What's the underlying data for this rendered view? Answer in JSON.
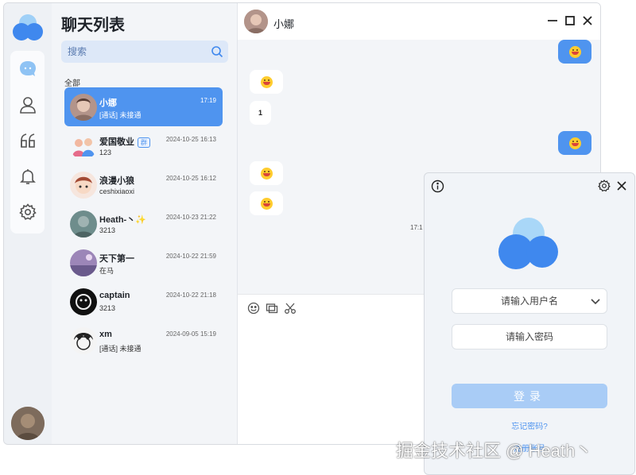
{
  "colors": {
    "accent": "#4f94ef",
    "accent_light": "#a9ccf6",
    "panel_bg": "#f3f5f8"
  },
  "sidebar": {
    "icons": [
      "chat-bubble-icon",
      "user-icon",
      "quote-icon",
      "bell-icon",
      "gear-icon"
    ]
  },
  "chat_list": {
    "title": "聊天列表",
    "search_placeholder": "搜索",
    "section_label": "全部",
    "items": [
      {
        "name": "小娜",
        "time": "17:19",
        "message": "[通话] 未接通",
        "active": true
      },
      {
        "name": "爱国敬业",
        "badge": "群",
        "time": "2024-10-25 16:13",
        "message": "123"
      },
      {
        "name": "浪漫小狼",
        "time": "2024-10-25 16:12",
        "message": "ceshixiaoxi"
      },
      {
        "name": "Heath-丶✨",
        "time": "2024-10-23 21:22",
        "message": "3213"
      },
      {
        "name": "天下第一",
        "time": "2024-10-22 21:59",
        "message": "在马"
      },
      {
        "name": "captain",
        "time": "2024-10-22 21:18",
        "message": "3213"
      },
      {
        "name": "xm",
        "time": "2024-09-05 15:19",
        "message": "[通话] 未接通"
      }
    ]
  },
  "chat": {
    "contact_name": "小娜",
    "bubble_text": "1",
    "timestamp": "17:1"
  },
  "login": {
    "username_placeholder": "请输入用户名",
    "password_placeholder": "请输入密码",
    "login_button": "登录",
    "forgot_password": "忘记密码?",
    "register": "注册账号"
  },
  "watermark": "掘金技术社区 @ Heath丶"
}
